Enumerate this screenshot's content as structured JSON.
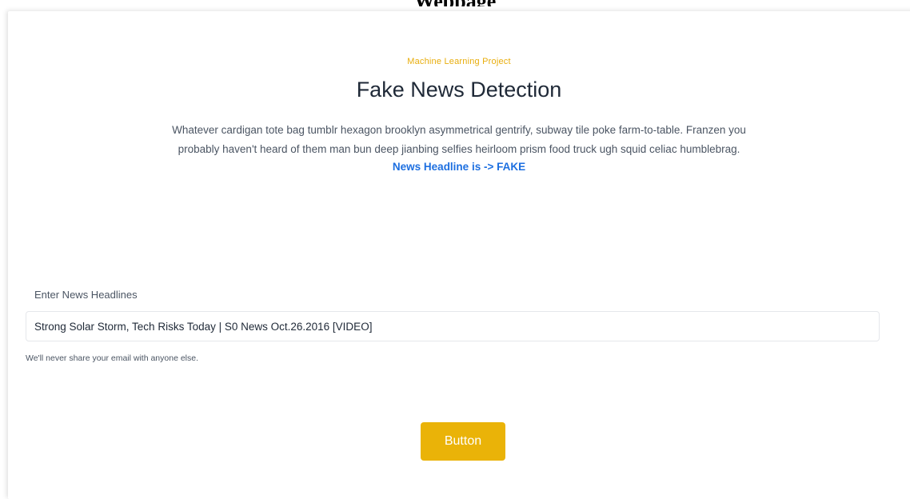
{
  "page": {
    "top_caption": "Webpage"
  },
  "hero": {
    "eyebrow": "Machine Learning Project",
    "title": "Fake News Detection",
    "description": "Whatever cardigan tote bag tumblr hexagon brooklyn asymmetrical gentrify, subway tile poke farm-to-table. Franzen you probably haven't heard of them man bun deep jianbing selfies heirloom prism food truck ugh squid celiac humblebrag.",
    "result": "News Headline is -> FAKE"
  },
  "form": {
    "label": "Enter News Headlines",
    "input_value": "Strong Solar Storm, Tech Risks Today | S0 News Oct.26.2016 [VIDEO]",
    "help_text": "We'll never share your email with anyone else.",
    "button_label": "Button"
  },
  "colors": {
    "accent": "#eab308",
    "eyebrow": "#e8ad0c",
    "result": "#1d6fe0"
  }
}
